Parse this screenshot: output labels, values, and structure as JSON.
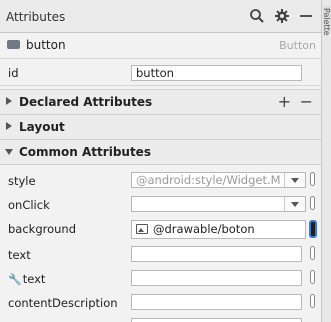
{
  "panel": {
    "title": "Attributes",
    "side_tab_label": "Palette"
  },
  "component": {
    "name": "button",
    "type": "Button"
  },
  "id_row": {
    "label": "id",
    "value": "button"
  },
  "sections": {
    "declared": "Declared Attributes",
    "layout": "Layout",
    "common": "Common Attributes"
  },
  "attrs": {
    "style": {
      "label": "style",
      "placeholder": "@android:style/Widget.M"
    },
    "onClick": {
      "label": "onClick",
      "value": ""
    },
    "background": {
      "label": "background",
      "value": "@drawable/boton"
    },
    "text": {
      "label": "text",
      "value": ""
    },
    "tools_text": {
      "label": "text",
      "value": ""
    },
    "contentDescription": {
      "label": "contentDescription",
      "value": ""
    }
  },
  "colors": {
    "accent": "#3a7bd5",
    "header_bg": "#ebebeb",
    "panel_bg": "#f2f2f2"
  },
  "icons": [
    "search-icon",
    "gear-icon",
    "minimize-icon",
    "plus-icon",
    "minus-icon",
    "image-icon",
    "wrench-icon"
  ]
}
